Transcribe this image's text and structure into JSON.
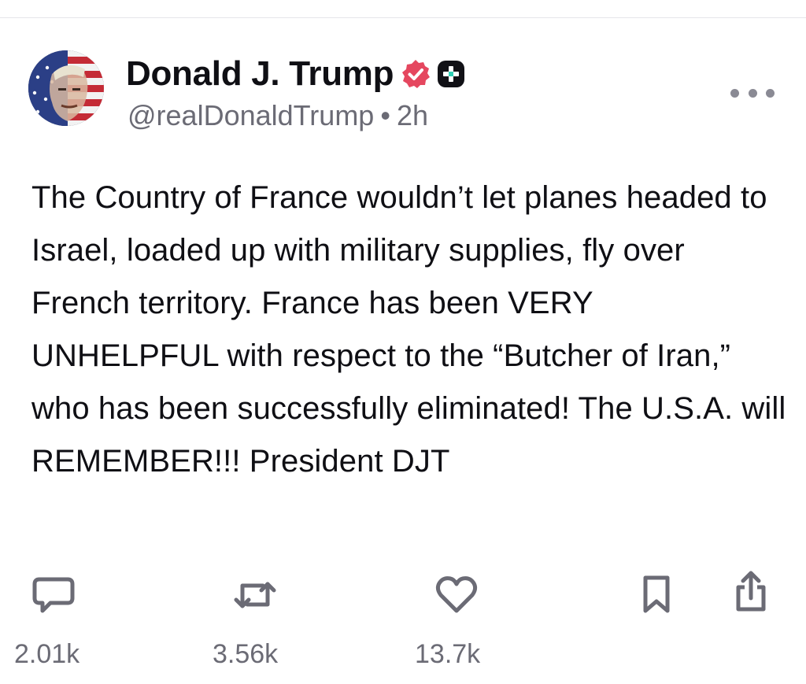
{
  "author": {
    "display_name": "Donald J. Trump",
    "handle": "@realDonaldTrump",
    "separator": "•",
    "time_ago": "2h",
    "verified_badge_color": "#e5475f",
    "avatar_icon": "profile-photo-with-flag"
  },
  "post": {
    "text": "The Country of France wouldn’t let planes headed to Israel, loaded up with military supplies, fly over French territory. France has been VERY UNHELPFUL with respect to the “Butcher of Iran,” who has been successfully eliminated! The U.S.A. will REMEMBER!!! President DJT"
  },
  "actions": {
    "replies": {
      "icon": "comment-icon",
      "count": "2.01k"
    },
    "reposts": {
      "icon": "repost-icon",
      "count": "3.56k"
    },
    "likes": {
      "icon": "heart-icon",
      "count": "13.7k"
    },
    "bookmark": {
      "icon": "bookmark-icon"
    },
    "share": {
      "icon": "share-icon"
    }
  },
  "colors": {
    "text": "#0f0f14",
    "muted": "#6b6b75",
    "icon": "#6b6b75",
    "verified": "#e5475f"
  }
}
